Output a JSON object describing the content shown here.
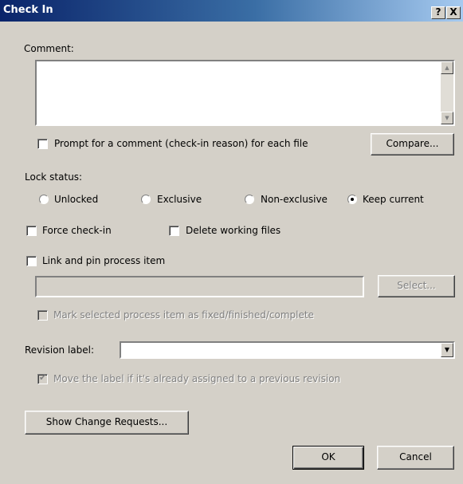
{
  "window": {
    "title": "Check In",
    "help_glyph": "?",
    "close_glyph": "X"
  },
  "comment": {
    "label": "Comment:",
    "value": ""
  },
  "prompt_comment": {
    "label": "Prompt for a comment (check-in reason) for each file",
    "checked": false
  },
  "compare_button": "Compare...",
  "lock_status": {
    "label": "Lock status:",
    "options": [
      "Unlocked",
      "Exclusive",
      "Non-exclusive",
      "Keep current"
    ],
    "selected": "Keep current"
  },
  "force_checkin": {
    "label": "Force check-in",
    "checked": false
  },
  "delete_working_files": {
    "label": "Delete working files",
    "checked": false
  },
  "link_pin": {
    "label": "Link and pin process item",
    "checked": false
  },
  "process_item": {
    "value": ""
  },
  "select_button": "Select...",
  "mark_fixed": {
    "label": "Mark selected process item as fixed/finished/complete",
    "checked": false
  },
  "revision_label": {
    "label": "Revision label:",
    "value": ""
  },
  "move_label": {
    "label": "Move the label if it's already assigned to a previous revision",
    "checked": true
  },
  "show_change_requests_button": "Show Change Requests...",
  "ok_button": "OK",
  "cancel_button": "Cancel"
}
